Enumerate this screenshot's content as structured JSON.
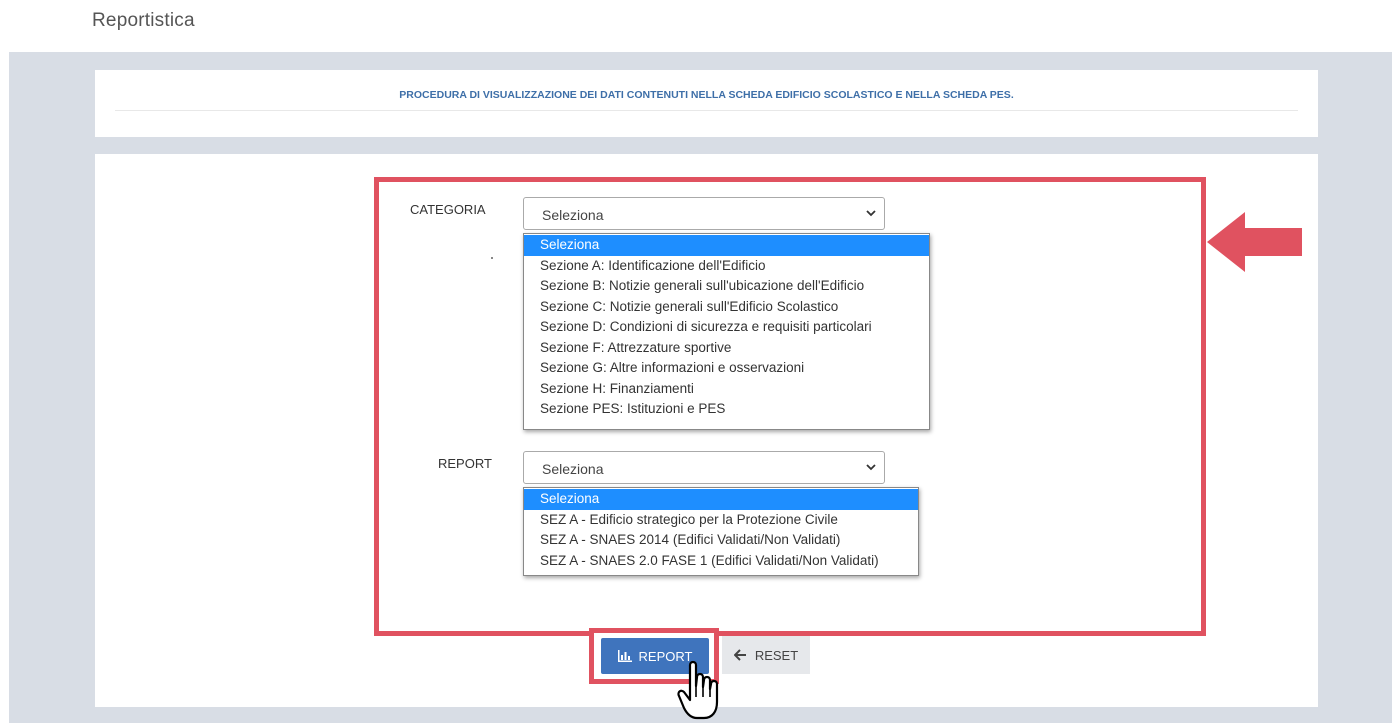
{
  "page": {
    "title": "Reportistica"
  },
  "info": {
    "text": "PROCEDURA DI VISUALIZZAZIONE DEI DATI CONTENUTI NELLA SCHEDA EDIFICIO SCOLASTICO E NELLA SCHEDA PES."
  },
  "categoria": {
    "label": "CATEGORIA",
    "selected": "Seleziona",
    "options": [
      "Seleziona",
      "Sezione A: Identificazione dell'Edificio",
      "Sezione B: Notizie generali sull'ubicazione dell'Edificio",
      "Sezione C: Notizie generali sull'Edificio Scolastico",
      "Sezione D: Condizioni di sicurezza e requisiti particolari",
      "Sezione F: Attrezzature sportive",
      "Sezione G: Altre informazioni e osservazioni",
      "Sezione H: Finanziamenti",
      "Sezione PES: Istituzioni e PES"
    ]
  },
  "report": {
    "label": "REPORT",
    "selected": "Seleziona",
    "options": [
      "Seleziona",
      "SEZ A - Edificio strategico per la Protezione Civile",
      "SEZ A - SNAES 2014 (Edifici Validati/Non Validati)",
      "SEZ A - SNAES 2.0 FASE 1 (Edifici Validati/Non Validati)"
    ]
  },
  "buttons": {
    "report": "REPORT",
    "reset": "RESET"
  },
  "colors": {
    "highlight": "#e05260",
    "primary": "#3f74bd",
    "dropdown_selected": "#1e8eff",
    "info_text": "#3e6fa8"
  },
  "icons": {
    "report": "bar-chart-icon",
    "reset": "arrow-left-icon",
    "pointer": "hand-cursor-icon",
    "annotation": "red-arrow-icon"
  }
}
